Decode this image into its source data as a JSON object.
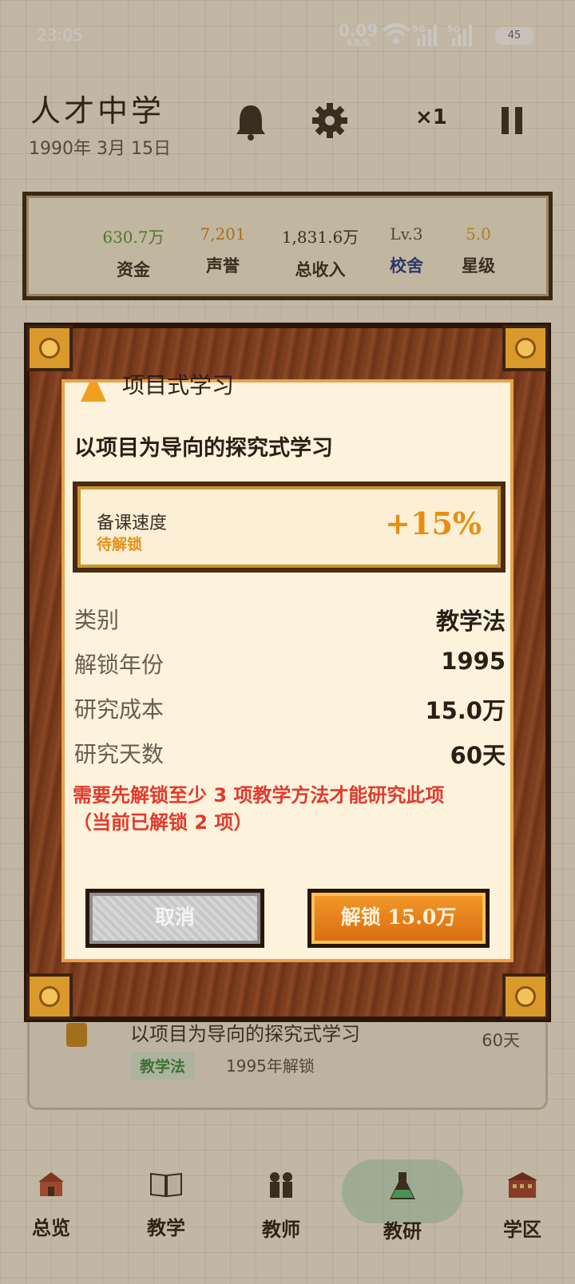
{
  "status_bar": {
    "time": "23:05",
    "net_speed": "0.09",
    "net_unit": "KB/S",
    "sig1": "5G",
    "sig2": "5G",
    "battery": "45"
  },
  "header": {
    "school_name": "人才中学",
    "date": "1990年 3月 15日",
    "speed": "×1",
    "icons": [
      "bell-icon",
      "gear-icon",
      "pause-icon"
    ]
  },
  "stats": [
    {
      "value": "630.7万",
      "label": "资金",
      "color": "#5a8f3a",
      "label_color": "#3a2e22"
    },
    {
      "value": "7,201",
      "label": "声誉",
      "color": "#d18a1a",
      "label_color": "#3a2e22"
    },
    {
      "value": "1,831.6万",
      "label": "总收入",
      "color": "#3a2e22",
      "label_color": "#3a2e22"
    },
    {
      "value": "Lv.3",
      "label": "校舍",
      "color": "#5a5046",
      "label_color": "#2a3a8a"
    },
    {
      "value": "5.0",
      "label": "星级",
      "color": "#d6a12a",
      "label_color": "#3a2e22"
    }
  ],
  "modal": {
    "title": "项目式学习",
    "subtitle": "以项目为导向的探究式学习",
    "effect": {
      "name": "备课速度",
      "state": "待解锁",
      "bonus": "+15%"
    },
    "rows": [
      {
        "key": "类别",
        "value": "教学法"
      },
      {
        "key": "解锁年份",
        "value": "1995"
      },
      {
        "key": "研究成本",
        "value": "15.0万"
      },
      {
        "key": "研究天数",
        "value": "60天"
      }
    ],
    "warning_line1": "需要先解锁至少 3 项教学方法才能研究此项",
    "warning_line2": "（当前已解锁 2 项）",
    "cancel_label": "取消",
    "unlock_label": "解锁 15.0万"
  },
  "list_item": {
    "title": "以项目为导向的探究式学习",
    "tag": "教学法",
    "unlock_year": "1995年解锁",
    "days": "60天"
  },
  "nav": [
    {
      "label": "总览",
      "icon": "school-building-icon"
    },
    {
      "label": "教学",
      "icon": "book-icon"
    },
    {
      "label": "教师",
      "icon": "teachers-icon"
    },
    {
      "label": "教研",
      "icon": "flask-icon",
      "active": true
    },
    {
      "label": "学区",
      "icon": "district-building-icon"
    }
  ]
}
